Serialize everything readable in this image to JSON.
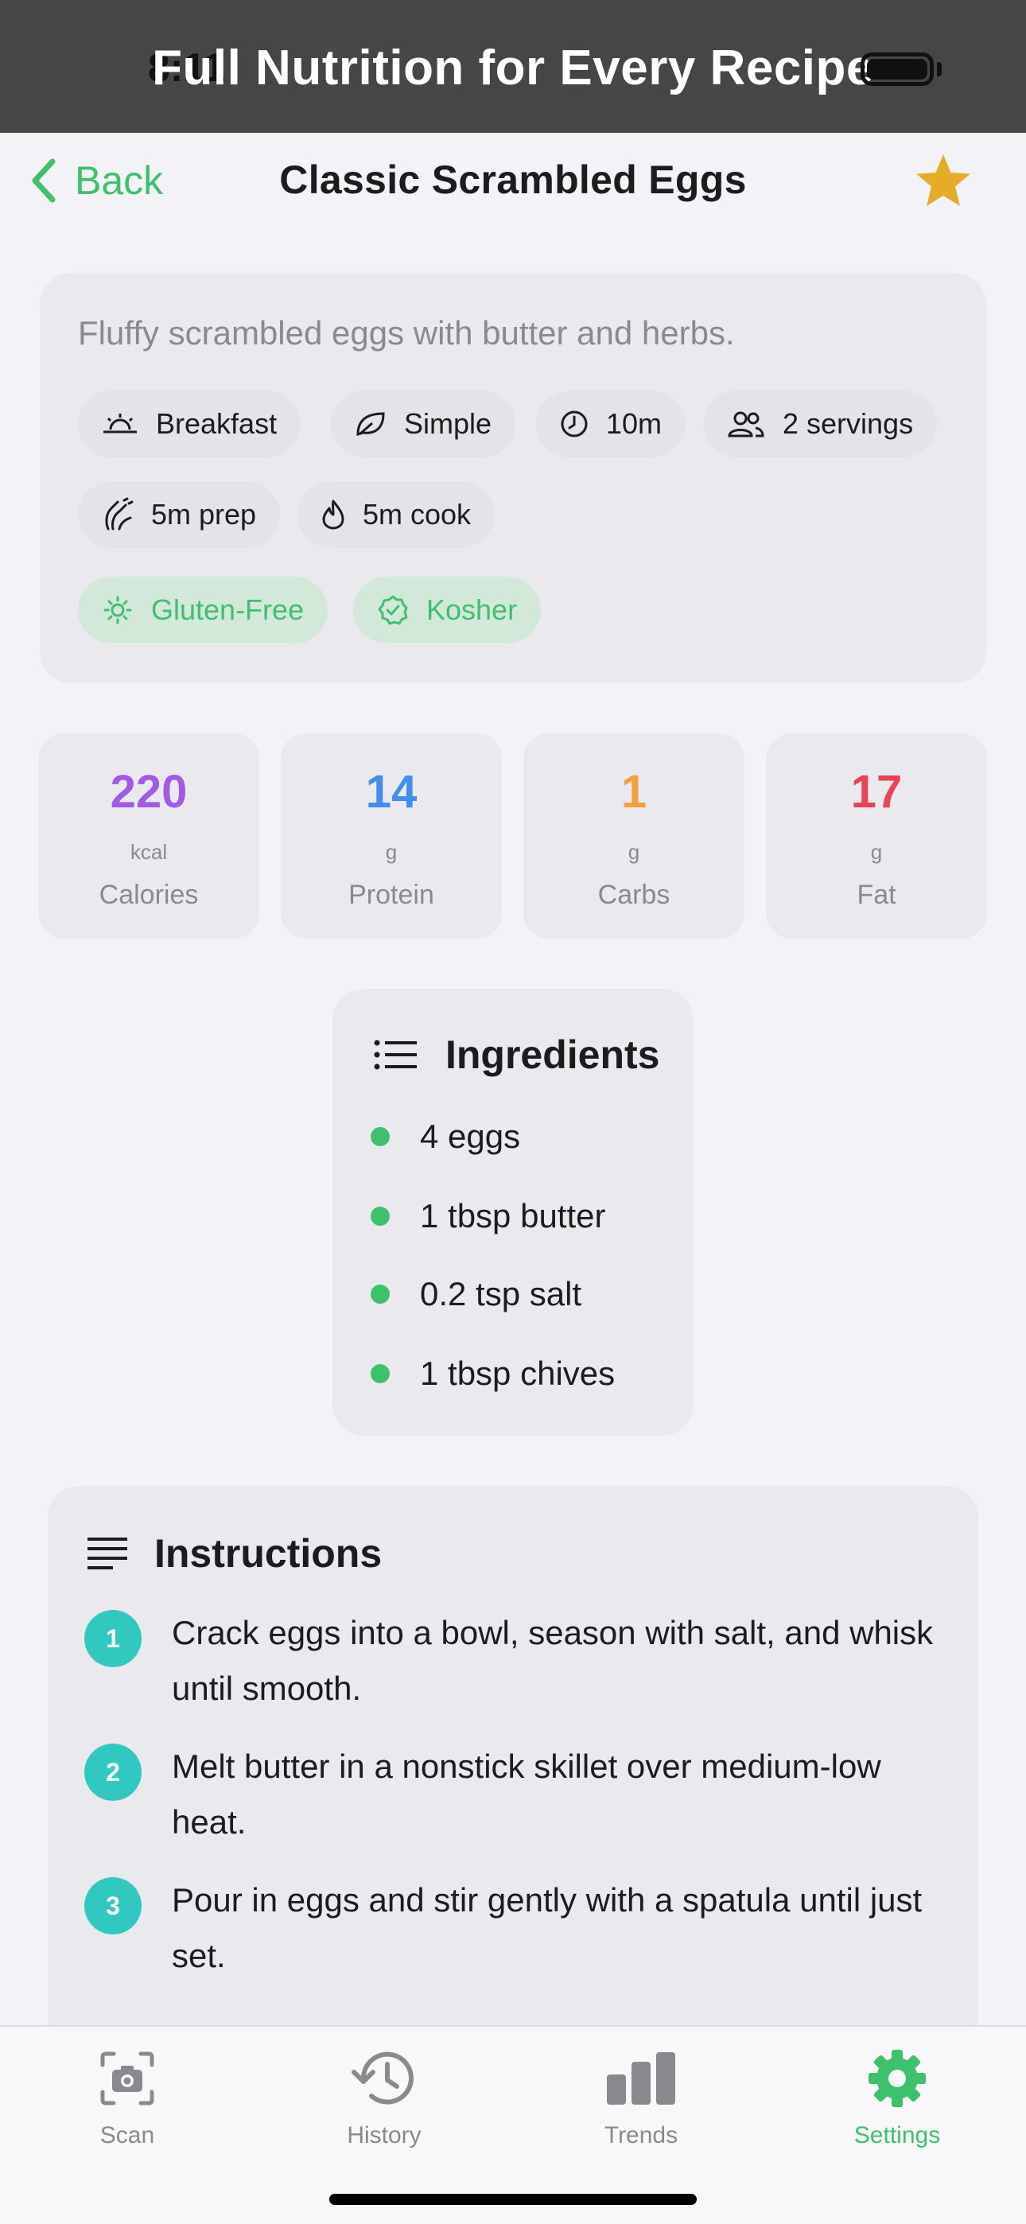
{
  "status_bar": {
    "time": "8:11"
  },
  "banner": {
    "title": "Full Nutrition for Every Recipe"
  },
  "nav": {
    "back_label": "Back",
    "title": "Classic Scrambled Eggs"
  },
  "summary": {
    "description": "Fluffy scrambled eggs with butter and herbs.",
    "chips": {
      "meal": "Breakfast",
      "difficulty": "Simple",
      "total_time": "10m",
      "servings": "2 servings",
      "prep": "5m prep",
      "cook": "5m cook"
    },
    "diet_tags": [
      "Gluten-Free",
      "Kosher"
    ]
  },
  "nutrition": [
    {
      "value": "220",
      "unit": "kcal",
      "label": "Calories",
      "color": "#a259e6"
    },
    {
      "value": "14",
      "unit": "g",
      "label": "Protein",
      "color": "#3f8ef0"
    },
    {
      "value": "1",
      "unit": "g",
      "label": "Carbs",
      "color": "#f5a13b"
    },
    {
      "value": "17",
      "unit": "g",
      "label": "Fat",
      "color": "#ec4256"
    }
  ],
  "ingredients": {
    "title": "Ingredients",
    "items": [
      "4 eggs",
      "1 tbsp butter",
      "0.2 tsp salt",
      "1 tbsp chives"
    ]
  },
  "instructions": {
    "title": "Instructions",
    "steps": [
      {
        "num": "1",
        "text": "Crack eggs into a bowl, season with salt, and whisk until smooth."
      },
      {
        "num": "2",
        "text": "Melt butter in a nonstick skillet over medium-low heat."
      },
      {
        "num": "3",
        "text": "Pour in eggs and stir gently with a spatula until just set."
      }
    ]
  },
  "tabs": [
    {
      "label": "Scan",
      "icon": "camera-icon"
    },
    {
      "label": "History",
      "icon": "history-icon"
    },
    {
      "label": "Trends",
      "icon": "bar-chart-icon"
    },
    {
      "label": "Settings",
      "icon": "gear-icon",
      "active": true
    }
  ],
  "colors": {
    "accent": "#3cc26a",
    "star": "#e6ac25",
    "step_badge": "#2fc9c1"
  }
}
